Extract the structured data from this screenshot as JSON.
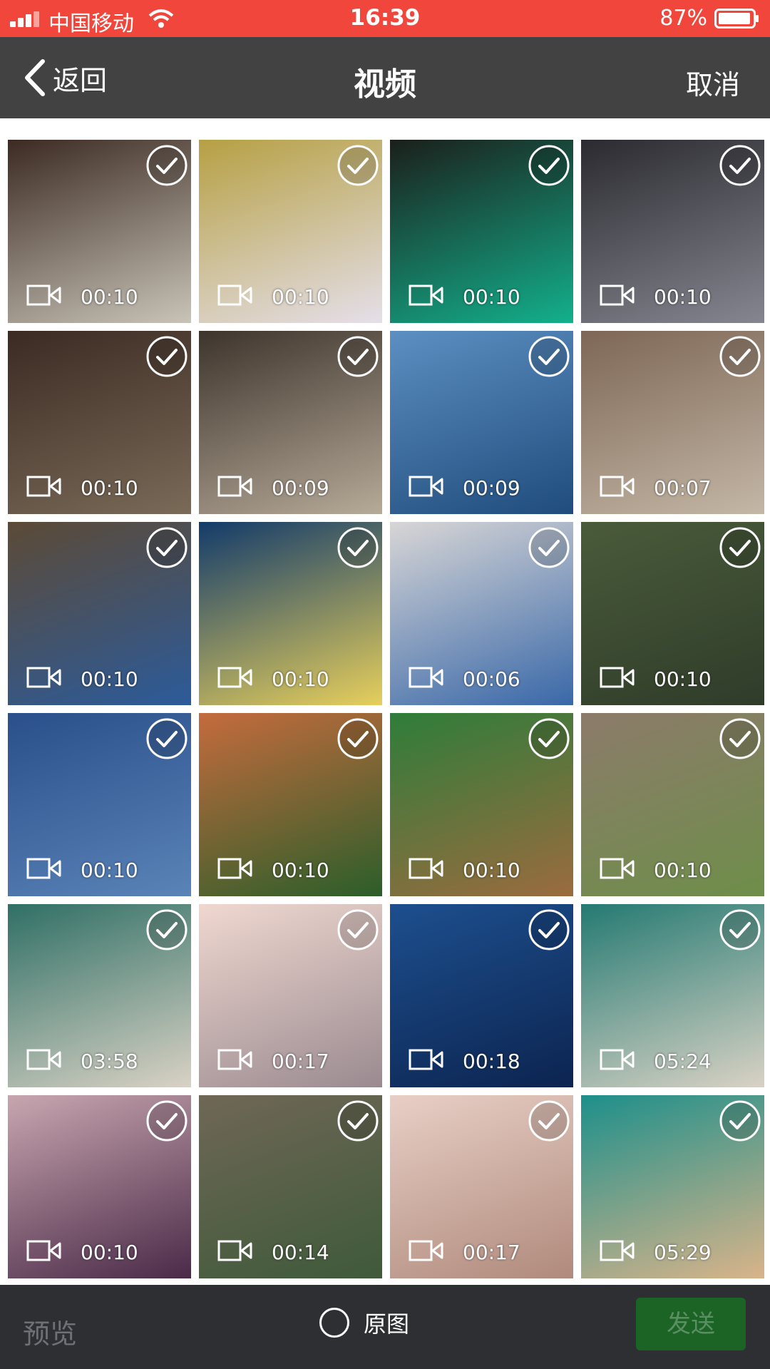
{
  "status_bar": {
    "carrier": "中国移动",
    "time": "16:39",
    "battery": "87%",
    "background": "#f0463c"
  },
  "nav": {
    "back_label": "返回",
    "title": "视频",
    "cancel_label": "取消"
  },
  "thumbnails": [
    {
      "duration": "00:10",
      "colors": [
        "#3b2a22",
        "#c9c4b8"
      ]
    },
    {
      "duration": "00:10",
      "colors": [
        "#b6a043",
        "#e5dfe9"
      ]
    },
    {
      "duration": "00:10",
      "colors": [
        "#1b1f1b",
        "#13b08c"
      ]
    },
    {
      "duration": "00:10",
      "colors": [
        "#2b2a30",
        "#858690"
      ]
    },
    {
      "duration": "00:10",
      "colors": [
        "#3b2a22",
        "#7a6a58"
      ]
    },
    {
      "duration": "00:09",
      "colors": [
        "#3d342c",
        "#b6aa98"
      ]
    },
    {
      "duration": "00:09",
      "colors": [
        "#5d8fc2",
        "#1f4c7c"
      ]
    },
    {
      "duration": "00:07",
      "colors": [
        "#7d6656",
        "#c4b7a5"
      ]
    },
    {
      "duration": "00:10",
      "colors": [
        "#5c4a36",
        "#2c5b9a"
      ]
    },
    {
      "duration": "00:10",
      "colors": [
        "#123b6a",
        "#e6cf5c"
      ]
    },
    {
      "duration": "00:06",
      "colors": [
        "#d8d6d6",
        "#3968a8"
      ]
    },
    {
      "duration": "00:10",
      "colors": [
        "#4a5b3a",
        "#2f3c2a"
      ]
    },
    {
      "duration": "00:10",
      "colors": [
        "#2a4f8a",
        "#5a84b8"
      ]
    },
    {
      "duration": "00:10",
      "colors": [
        "#c56b3d",
        "#2b5e2a"
      ]
    },
    {
      "duration": "00:10",
      "colors": [
        "#2e7d3a",
        "#9b6b3f"
      ]
    },
    {
      "duration": "00:10",
      "colors": [
        "#8c7b6a",
        "#6e8e4a"
      ]
    },
    {
      "duration": "03:58",
      "colors": [
        "#2f6f65",
        "#d9d2c5"
      ]
    },
    {
      "duration": "00:17",
      "colors": [
        "#f0d8d0",
        "#9a8a90"
      ]
    },
    {
      "duration": "00:18",
      "colors": [
        "#1d4f8e",
        "#0c2450"
      ]
    },
    {
      "duration": "05:24",
      "colors": [
        "#247a72",
        "#d9d2c5"
      ]
    },
    {
      "duration": "00:10",
      "colors": [
        "#c8a6b0",
        "#4a2a48"
      ]
    },
    {
      "duration": "00:14",
      "colors": [
        "#6f6756",
        "#3f5a3a"
      ]
    },
    {
      "duration": "00:17",
      "colors": [
        "#e8cfc6",
        "#b08a7c"
      ]
    },
    {
      "duration": "05:29",
      "colors": [
        "#1d8f8a",
        "#d9b48a"
      ]
    }
  ],
  "bottom_bar": {
    "preview_label": "预览",
    "original_label": "原图",
    "send_label": "发送",
    "send_color": "#1c6326"
  }
}
